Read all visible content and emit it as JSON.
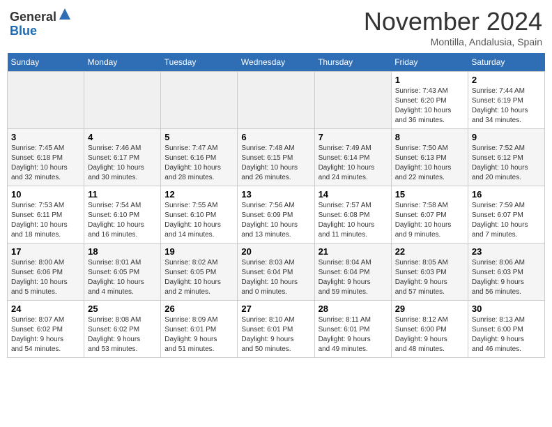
{
  "logo": {
    "line1": "General",
    "line2": "Blue"
  },
  "title": "November 2024",
  "location": "Montilla, Andalusia, Spain",
  "weekdays": [
    "Sunday",
    "Monday",
    "Tuesday",
    "Wednesday",
    "Thursday",
    "Friday",
    "Saturday"
  ],
  "weeks": [
    [
      {
        "day": "",
        "info": "",
        "empty": true
      },
      {
        "day": "",
        "info": "",
        "empty": true
      },
      {
        "day": "",
        "info": "",
        "empty": true
      },
      {
        "day": "",
        "info": "",
        "empty": true
      },
      {
        "day": "",
        "info": "",
        "empty": true
      },
      {
        "day": "1",
        "info": "Sunrise: 7:43 AM\nSunset: 6:20 PM\nDaylight: 10 hours\nand 36 minutes."
      },
      {
        "day": "2",
        "info": "Sunrise: 7:44 AM\nSunset: 6:19 PM\nDaylight: 10 hours\nand 34 minutes."
      }
    ],
    [
      {
        "day": "3",
        "info": "Sunrise: 7:45 AM\nSunset: 6:18 PM\nDaylight: 10 hours\nand 32 minutes."
      },
      {
        "day": "4",
        "info": "Sunrise: 7:46 AM\nSunset: 6:17 PM\nDaylight: 10 hours\nand 30 minutes."
      },
      {
        "day": "5",
        "info": "Sunrise: 7:47 AM\nSunset: 6:16 PM\nDaylight: 10 hours\nand 28 minutes."
      },
      {
        "day": "6",
        "info": "Sunrise: 7:48 AM\nSunset: 6:15 PM\nDaylight: 10 hours\nand 26 minutes."
      },
      {
        "day": "7",
        "info": "Sunrise: 7:49 AM\nSunset: 6:14 PM\nDaylight: 10 hours\nand 24 minutes."
      },
      {
        "day": "8",
        "info": "Sunrise: 7:50 AM\nSunset: 6:13 PM\nDaylight: 10 hours\nand 22 minutes."
      },
      {
        "day": "9",
        "info": "Sunrise: 7:52 AM\nSunset: 6:12 PM\nDaylight: 10 hours\nand 20 minutes."
      }
    ],
    [
      {
        "day": "10",
        "info": "Sunrise: 7:53 AM\nSunset: 6:11 PM\nDaylight: 10 hours\nand 18 minutes."
      },
      {
        "day": "11",
        "info": "Sunrise: 7:54 AM\nSunset: 6:10 PM\nDaylight: 10 hours\nand 16 minutes."
      },
      {
        "day": "12",
        "info": "Sunrise: 7:55 AM\nSunset: 6:10 PM\nDaylight: 10 hours\nand 14 minutes."
      },
      {
        "day": "13",
        "info": "Sunrise: 7:56 AM\nSunset: 6:09 PM\nDaylight: 10 hours\nand 13 minutes."
      },
      {
        "day": "14",
        "info": "Sunrise: 7:57 AM\nSunset: 6:08 PM\nDaylight: 10 hours\nand 11 minutes."
      },
      {
        "day": "15",
        "info": "Sunrise: 7:58 AM\nSunset: 6:07 PM\nDaylight: 10 hours\nand 9 minutes."
      },
      {
        "day": "16",
        "info": "Sunrise: 7:59 AM\nSunset: 6:07 PM\nDaylight: 10 hours\nand 7 minutes."
      }
    ],
    [
      {
        "day": "17",
        "info": "Sunrise: 8:00 AM\nSunset: 6:06 PM\nDaylight: 10 hours\nand 5 minutes."
      },
      {
        "day": "18",
        "info": "Sunrise: 8:01 AM\nSunset: 6:05 PM\nDaylight: 10 hours\nand 4 minutes."
      },
      {
        "day": "19",
        "info": "Sunrise: 8:02 AM\nSunset: 6:05 PM\nDaylight: 10 hours\nand 2 minutes."
      },
      {
        "day": "20",
        "info": "Sunrise: 8:03 AM\nSunset: 6:04 PM\nDaylight: 10 hours\nand 0 minutes."
      },
      {
        "day": "21",
        "info": "Sunrise: 8:04 AM\nSunset: 6:04 PM\nDaylight: 9 hours\nand 59 minutes."
      },
      {
        "day": "22",
        "info": "Sunrise: 8:05 AM\nSunset: 6:03 PM\nDaylight: 9 hours\nand 57 minutes."
      },
      {
        "day": "23",
        "info": "Sunrise: 8:06 AM\nSunset: 6:03 PM\nDaylight: 9 hours\nand 56 minutes."
      }
    ],
    [
      {
        "day": "24",
        "info": "Sunrise: 8:07 AM\nSunset: 6:02 PM\nDaylight: 9 hours\nand 54 minutes."
      },
      {
        "day": "25",
        "info": "Sunrise: 8:08 AM\nSunset: 6:02 PM\nDaylight: 9 hours\nand 53 minutes."
      },
      {
        "day": "26",
        "info": "Sunrise: 8:09 AM\nSunset: 6:01 PM\nDaylight: 9 hours\nand 51 minutes."
      },
      {
        "day": "27",
        "info": "Sunrise: 8:10 AM\nSunset: 6:01 PM\nDaylight: 9 hours\nand 50 minutes."
      },
      {
        "day": "28",
        "info": "Sunrise: 8:11 AM\nSunset: 6:01 PM\nDaylight: 9 hours\nand 49 minutes."
      },
      {
        "day": "29",
        "info": "Sunrise: 8:12 AM\nSunset: 6:00 PM\nDaylight: 9 hours\nand 48 minutes."
      },
      {
        "day": "30",
        "info": "Sunrise: 8:13 AM\nSunset: 6:00 PM\nDaylight: 9 hours\nand 46 minutes."
      }
    ]
  ]
}
